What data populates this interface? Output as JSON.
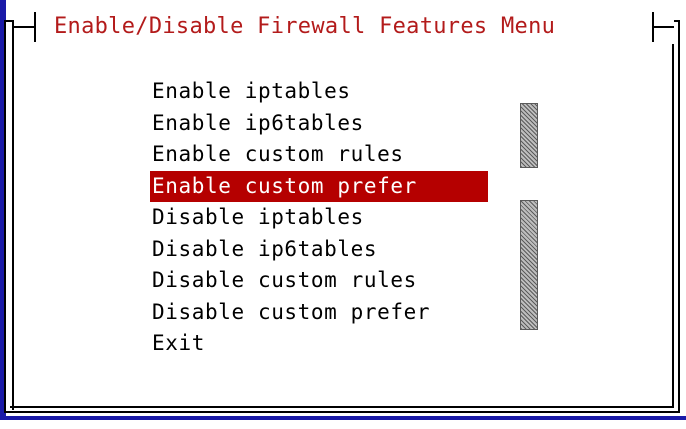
{
  "dialog": {
    "title": "Enable/Disable Firewall Features Menu"
  },
  "menu": {
    "items": [
      {
        "label": "Enable iptables",
        "selected": false
      },
      {
        "label": "Enable ip6tables",
        "selected": false
      },
      {
        "label": "Enable custom rules",
        "selected": false
      },
      {
        "label": "Enable custom prefer",
        "selected": true
      },
      {
        "label": "Disable iptables",
        "selected": false
      },
      {
        "label": "Disable ip6tables",
        "selected": false
      },
      {
        "label": "Disable custom rules",
        "selected": false
      },
      {
        "label": "Disable custom prefer",
        "selected": false
      },
      {
        "label": "Exit",
        "selected": false
      }
    ]
  },
  "colors": {
    "title_text": "#b31b1b",
    "selection_background": "#b50000",
    "selection_text": "#ffffff",
    "frame": "#000000",
    "terminal_edge": "#1a1aa8"
  }
}
